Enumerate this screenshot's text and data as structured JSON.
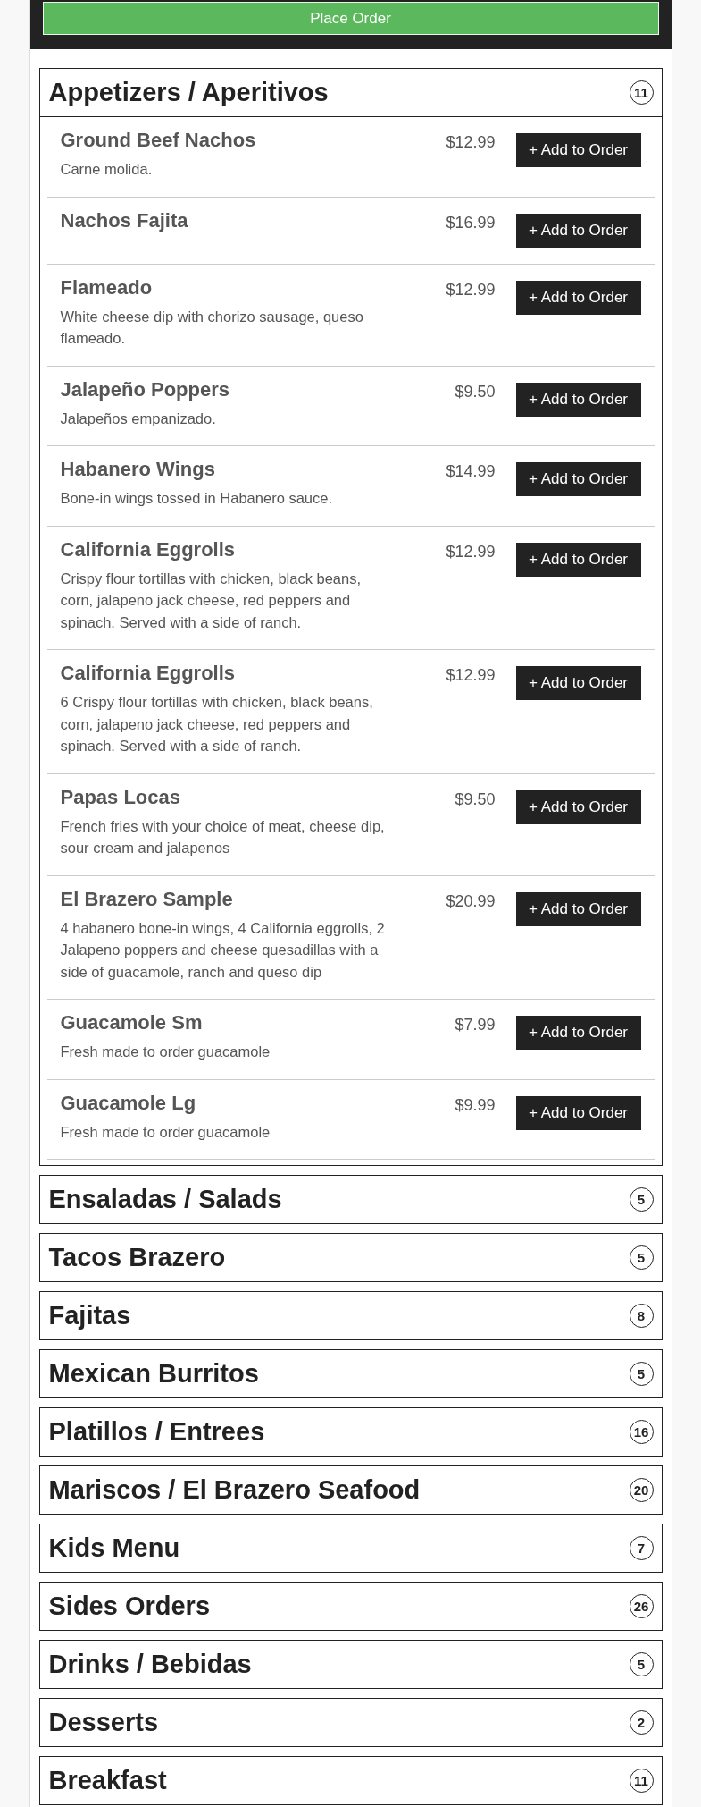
{
  "place_order_button": "Place Order",
  "categories": [
    {
      "name": "Appetizers / Aperitivos",
      "count": "11",
      "expanded": true,
      "items": [
        {
          "name": "Ground Beef Nachos",
          "price": "$12.99",
          "description": "Carne molida.",
          "button": "+ Add to Order"
        },
        {
          "name": "Nachos Fajita",
          "price": "$16.99",
          "button": "+ Add to Order"
        },
        {
          "name": "Flameado",
          "price": "$12.99",
          "description": "White cheese dip with chorizo sausage, queso flameado.",
          "button": "+ Add to Order"
        },
        {
          "name": "Jalapeño Poppers",
          "price": "$9.50",
          "description": "Jalapeños empanizado.",
          "button": "+ Add to Order"
        },
        {
          "name": "Habanero Wings",
          "price": "$14.99",
          "description": "Bone-in wings tossed in Habanero sauce.",
          "button": "+ Add to Order"
        },
        {
          "name": "California Eggrolls",
          "price": "$12.99",
          "description": "Crispy flour tortillas with chicken, black beans, corn, jalapeno jack cheese, red peppers and spinach. Served with a side of ranch.",
          "button": "+ Add to Order"
        },
        {
          "name": "California Eggrolls",
          "price": "$12.99",
          "description": "6 Crispy flour tortillas with chicken, black beans, corn, jalapeno jack cheese, red peppers and spinach. Served with a side of ranch.",
          "button": "+ Add to Order"
        },
        {
          "name": "Papas Locas",
          "price": "$9.50",
          "description": "French fries with your choice of meat, cheese dip, sour cream and jalapenos",
          "button": "+ Add to Order"
        },
        {
          "name": "El Brazero Sample",
          "price": "$20.99",
          "description": "4 habanero bone-in wings, 4 California eggrolls, 2 Jalapeno poppers and cheese quesadillas with a side of guacamole, ranch and queso dip",
          "button": "+ Add to Order"
        },
        {
          "name": "Guacamole Sm",
          "price": "$7.99",
          "description": "Fresh made to order guacamole",
          "button": "+ Add to Order"
        },
        {
          "name": "Guacamole Lg",
          "price": "$9.99",
          "description": "Fresh made to order guacamole",
          "button": "+ Add to Order"
        }
      ]
    },
    {
      "name": "Ensaladas / Salads",
      "count": "5",
      "expanded": false
    },
    {
      "name": "Tacos Brazero",
      "count": "5",
      "expanded": false
    },
    {
      "name": "Fajitas",
      "count": "8",
      "expanded": false
    },
    {
      "name": "Mexican Burritos",
      "count": "5",
      "expanded": false
    },
    {
      "name": "Platillos / Entrees",
      "count": "16",
      "expanded": false
    },
    {
      "name": "Mariscos / El Brazero Seafood",
      "count": "20",
      "expanded": false
    },
    {
      "name": "Kids Menu",
      "count": "7",
      "expanded": false
    },
    {
      "name": "Sides Orders",
      "count": "26",
      "expanded": false
    },
    {
      "name": "Drinks / Bebidas",
      "count": "5",
      "expanded": false
    },
    {
      "name": "Desserts",
      "count": "2",
      "expanded": false
    },
    {
      "name": "Breakfast",
      "count": "11",
      "expanded": false
    }
  ]
}
